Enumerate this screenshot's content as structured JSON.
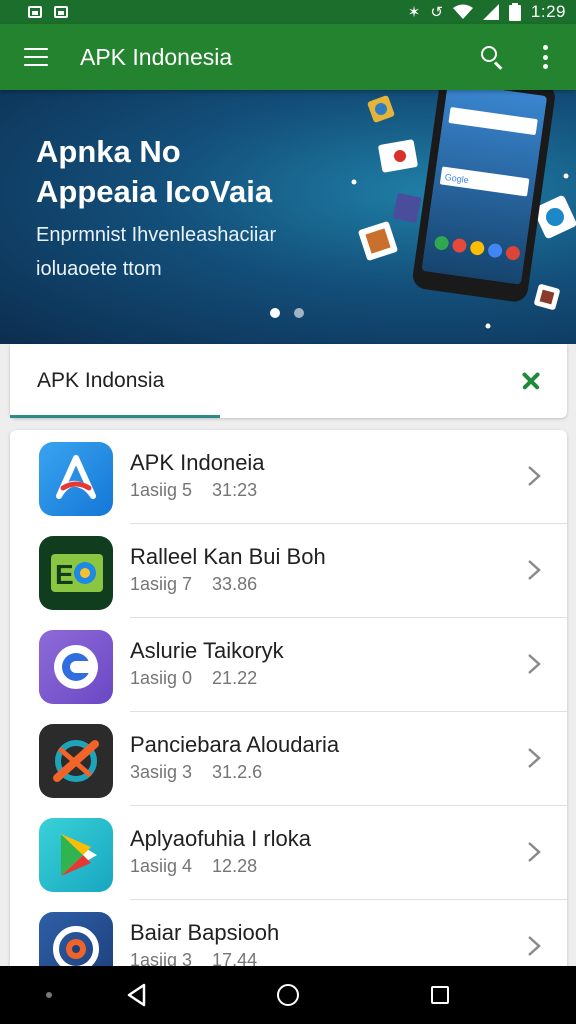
{
  "status_bar": {
    "time": "1:29",
    "icons": [
      "image-icon",
      "gallery-icon",
      "bluetooth-icon",
      "vibrate-icon",
      "wifi-icon",
      "signal-icon",
      "battery-icon"
    ]
  },
  "app_bar": {
    "title": "APK Indonesia",
    "icons": [
      "menu-icon",
      "search-icon",
      "more-icon"
    ],
    "color": "#23832f"
  },
  "banner": {
    "title_line1": "Apnka No",
    "title_line2": "Appeaia IcoVaia",
    "subtitle_line1": "Enprmnist Ihvenleashaciiar",
    "subtitle_line2": "ioluaoete ttom",
    "page_count": 2,
    "active_page": 1,
    "phone_search_1": "",
    "phone_search_2": "Gogle"
  },
  "search": {
    "query": "APK Indonsia",
    "accent_color": "#1e8a3a"
  },
  "apps": [
    {
      "name": "APK Indoneia",
      "meta_a": "1asiig 5",
      "meta_b": "31:23",
      "icon": "apk-store-icon"
    },
    {
      "name": "Ralleel Kan Bui Boh",
      "meta_a": "1asiig 7",
      "meta_b": "33.86",
      "icon": "eo-app-icon"
    },
    {
      "name": "Aslurie Taikoryk",
      "meta_a": "1asiig 0",
      "meta_b": "21.22",
      "icon": "purple-app-icon"
    },
    {
      "name": "Panciebara Aloudaria",
      "meta_a": "3asiig 3",
      "meta_b": "31.2.6",
      "icon": "dark-app-icon"
    },
    {
      "name": "Aplyaofuhia I rloka",
      "meta_a": "1asiig 4",
      "meta_b": "12.28",
      "icon": "play-icon"
    },
    {
      "name": "Baiar Bapsiooh",
      "meta_a": "1asiig 3",
      "meta_b": "17.44",
      "icon": "blue-app-icon"
    }
  ],
  "nav_bar": {
    "icons": [
      "back-icon",
      "home-icon",
      "recent-apps-icon"
    ]
  }
}
